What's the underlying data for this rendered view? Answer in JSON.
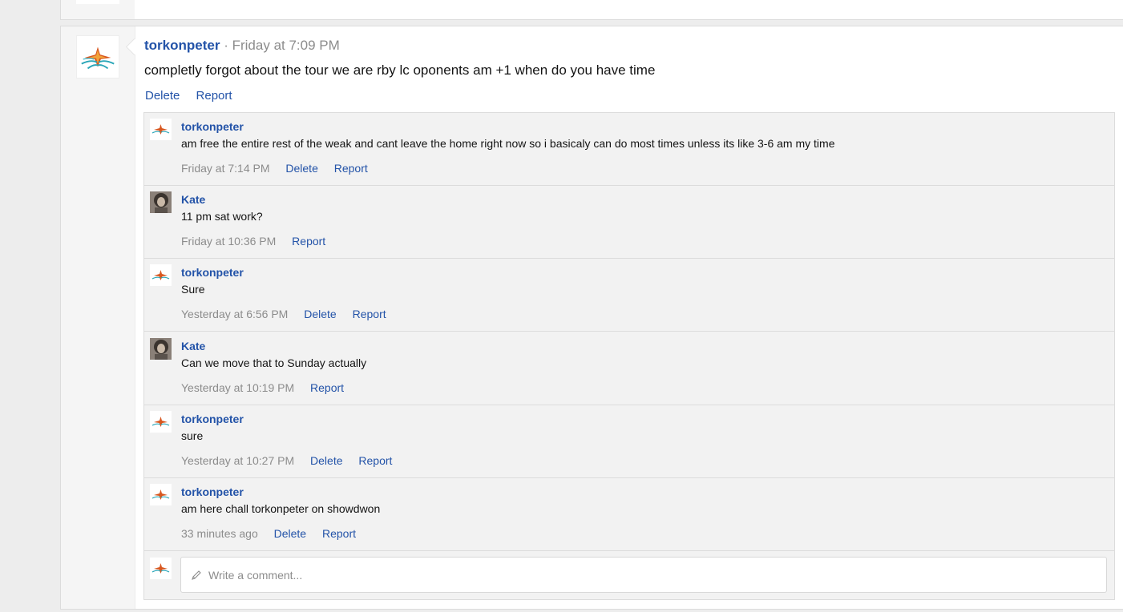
{
  "post": {
    "author": "torkonpeter",
    "separator": "·",
    "time": "Friday at 7:09 PM",
    "body": "completly forgot about the tour we are rby lc oponents am +1 when do you have time",
    "actions": {
      "delete": "Delete",
      "report": "Report"
    }
  },
  "comments": [
    {
      "author": "torkonpeter",
      "avatar": "starfish-avatar",
      "body": "am free the entire rest of the weak and cant leave the home right now so i basicaly can do most times unless its like 3-6 am my time",
      "time": "Friday at 7:14 PM",
      "delete": "Delete",
      "report": "Report"
    },
    {
      "author": "Kate",
      "avatar": "photo-avatar",
      "body": "11 pm sat work?",
      "time": "Friday at 10:36 PM",
      "report": "Report"
    },
    {
      "author": "torkonpeter",
      "avatar": "starfish-avatar",
      "body": "Sure",
      "time": "Yesterday at 6:56 PM",
      "delete": "Delete",
      "report": "Report"
    },
    {
      "author": "Kate",
      "avatar": "photo-avatar",
      "body": "Can we move that to Sunday actually",
      "time": "Yesterday at 10:19 PM",
      "report": "Report"
    },
    {
      "author": "torkonpeter",
      "avatar": "starfish-avatar",
      "body": "sure",
      "time": "Yesterday at 10:27 PM",
      "delete": "Delete",
      "report": "Report"
    },
    {
      "author": "torkonpeter",
      "avatar": "starfish-avatar",
      "body": "am here chall torkonpeter on showdwon",
      "time": "33 minutes ago",
      "delete": "Delete",
      "report": "Report"
    }
  ],
  "reply": {
    "placeholder": "Write a comment...",
    "icon": "pencil-icon"
  },
  "colors": {
    "link": "#2353a8",
    "muted": "#8c8c8c",
    "background": "#ededed",
    "comments_bg": "#f2f2f2"
  }
}
